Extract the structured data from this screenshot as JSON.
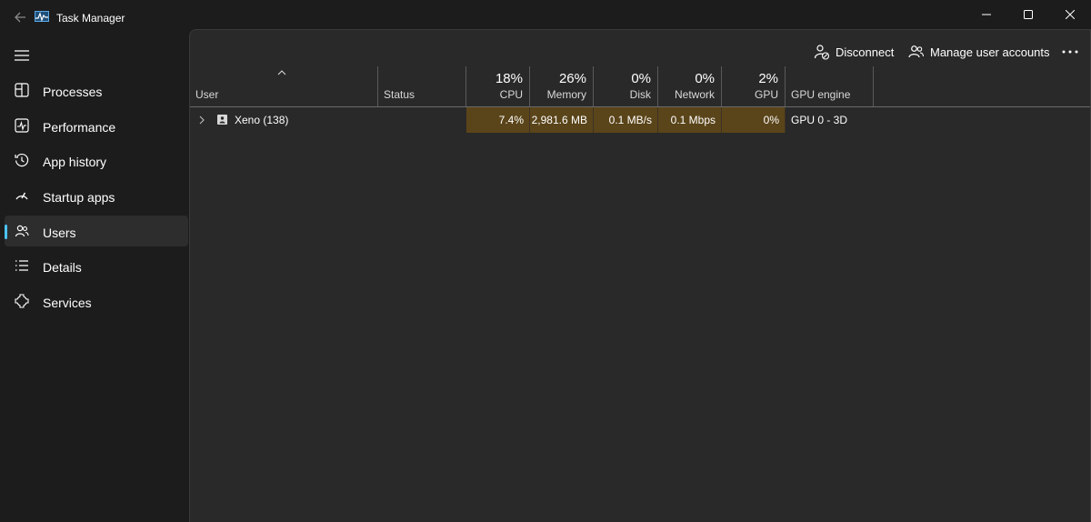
{
  "window": {
    "title": "Task Manager",
    "icons": {
      "back": "back-arrow-icon",
      "app": "task-manager-icon",
      "minimize": "minimize-icon",
      "maximize": "maximize-icon",
      "close": "close-icon"
    }
  },
  "sidebar": {
    "menu_icon": "hamburger-icon",
    "items": [
      {
        "label": "Processes",
        "icon": "processes-icon",
        "selected": false
      },
      {
        "label": "Performance",
        "icon": "performance-icon",
        "selected": false
      },
      {
        "label": "App history",
        "icon": "app-history-icon",
        "selected": false
      },
      {
        "label": "Startup apps",
        "icon": "startup-apps-icon",
        "selected": false
      },
      {
        "label": "Users",
        "icon": "users-icon",
        "selected": true
      },
      {
        "label": "Details",
        "icon": "details-icon",
        "selected": false
      },
      {
        "label": "Services",
        "icon": "services-icon",
        "selected": false
      }
    ]
  },
  "toolbar": {
    "disconnect_label": "Disconnect",
    "manage_label": "Manage user accounts",
    "more_icon": "more-options-icon"
  },
  "table": {
    "columns": {
      "user": {
        "label": "User"
      },
      "status": {
        "label": "Status"
      },
      "cpu": {
        "pct": "18%",
        "label": "CPU"
      },
      "memory": {
        "pct": "26%",
        "label": "Memory"
      },
      "disk": {
        "pct": "0%",
        "label": "Disk"
      },
      "network": {
        "pct": "0%",
        "label": "Network"
      },
      "gpu": {
        "pct": "2%",
        "label": "GPU"
      },
      "gpu_engine": {
        "label": "GPU engine"
      }
    },
    "rows": [
      {
        "user": "Xeno (138)",
        "status": "",
        "cpu": "7.4%",
        "memory": "2,981.6 MB",
        "disk": "0.1 MB/s",
        "network": "0.1 Mbps",
        "gpu": "0%",
        "gpu_engine": "GPU 0 - 3D"
      }
    ]
  },
  "colors": {
    "accent": "#4cc2ff",
    "heat": "#5a4419",
    "background": "#1c1c1c",
    "panel": "#292929"
  }
}
